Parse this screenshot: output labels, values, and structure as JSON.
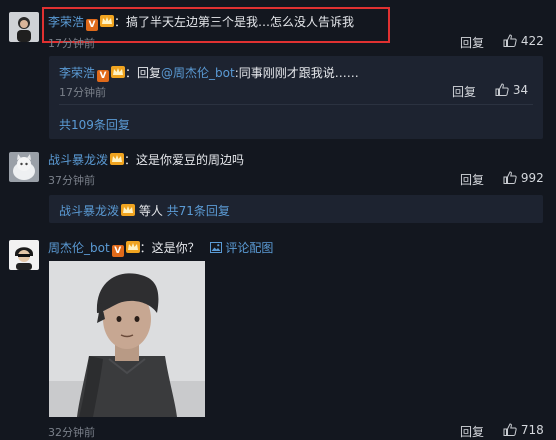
{
  "comments": [
    {
      "user": "李荣浩",
      "text": "：搞了半天左边第三个是我…怎么没人告诉我",
      "time": "17分钟前",
      "reply_label": "回复",
      "likes": "422",
      "sub_reply": {
        "user": "李荣浩",
        "reply_prefix": "：回复",
        "mention": "@周杰伦_bot",
        "text": ":同事刚刚才跟我说……",
        "time": "17分钟前",
        "reply_label": "回复",
        "likes": "34"
      },
      "more_replies": "共109条回复"
    },
    {
      "user": "战斗暴龙泼",
      "text": "：这是你爱豆的周边吗",
      "time": "37分钟前",
      "reply_label": "回复",
      "likes": "992",
      "summary_user": "战斗暴龙泼",
      "summary_mid": " 等人 ",
      "summary_link": "共71条回复"
    },
    {
      "user": "周杰伦_bot",
      "text": "：这是你？",
      "image_link": "评论配图",
      "time": "32分钟前",
      "reply_label": "回复",
      "likes": "718"
    }
  ],
  "badges": {
    "verified": "V"
  },
  "colors": {
    "background": "#13171f",
    "username": "#5b9bd5",
    "highlight": "#e03131"
  }
}
